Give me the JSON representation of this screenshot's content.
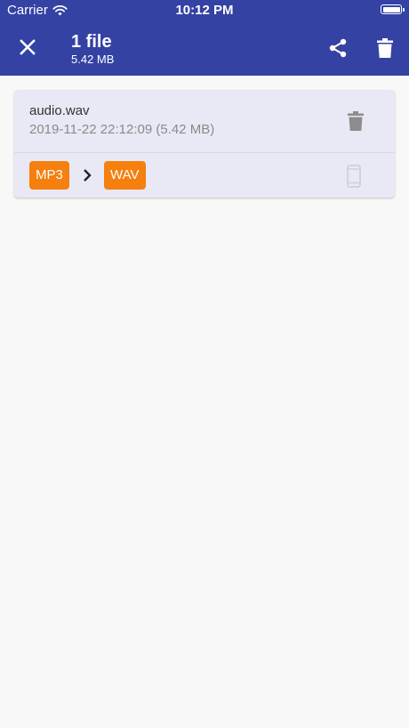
{
  "status_bar": {
    "carrier": "Carrier",
    "time": "10:12 PM"
  },
  "header": {
    "title": "1 file",
    "subtitle": "5.42 MB",
    "background_color": "#3442a4",
    "icons": {
      "close": "close-icon",
      "share": "share-icon",
      "delete": "trash-icon"
    }
  },
  "files": [
    {
      "name": "audio.wav",
      "meta": "2019-11-22 22:12:09 (5.42 MB)",
      "from_format": "MP3",
      "to_format": "WAV",
      "badge_color": "#f57f0f",
      "icons": {
        "delete": "trash-icon",
        "arrow": "chevron-right-icon",
        "device": "phone-icon"
      }
    }
  ]
}
